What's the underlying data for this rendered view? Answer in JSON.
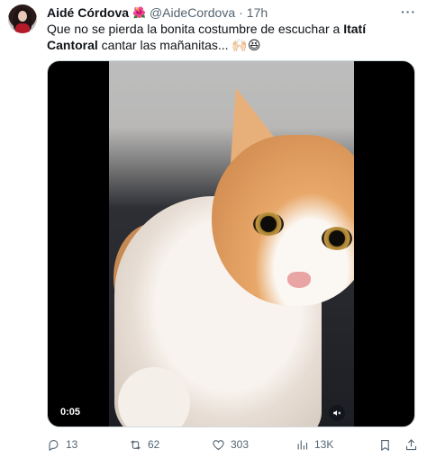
{
  "author": {
    "name": "Aidé Córdova",
    "emoji": "🌺",
    "handle": "@AideCordova",
    "separator": "·",
    "time": "17h",
    "more": "···"
  },
  "tweet": {
    "text_before": "Que no se pierda la bonita costumbre de escuchar a ",
    "text_bold": "Itatí Cantoral",
    "text_after": " cantar las mañanitas... 🙌🏻😆"
  },
  "media": {
    "duration": "0:05",
    "mute_icon": "speaker-muted-icon"
  },
  "actions": {
    "replies": "13",
    "reposts": "62",
    "likes": "303",
    "views": "13K"
  },
  "colors": {
    "text": "#0f1419",
    "muted": "#536471",
    "border": "#cfd9de"
  }
}
